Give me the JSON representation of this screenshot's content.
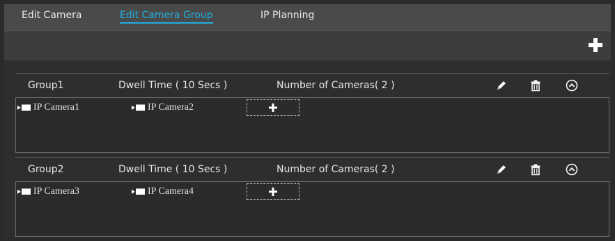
{
  "tabs": [
    {
      "label": "Edit Camera",
      "active": false
    },
    {
      "label": "Edit Camera Group",
      "active": true
    },
    {
      "label": "IP Planning",
      "active": false
    }
  ],
  "toolbar": {
    "add_icon": "plus-icon"
  },
  "groups": [
    {
      "name": "Group1",
      "dwell": "Dwell Time ( 10 Secs )",
      "count": "Number of Cameras( 2 )",
      "cameras": [
        "IP Camera1",
        "IP Camera2"
      ]
    },
    {
      "name": "Group2",
      "dwell": "Dwell Time ( 10 Secs )",
      "count": "Number of Cameras( 2 )",
      "cameras": [
        "IP Camera3",
        "IP Camera4"
      ]
    }
  ],
  "icons": {
    "edit": "pencil-icon",
    "delete": "trash-icon",
    "collapse": "chevron-up-circle-icon",
    "camera": "camera-icon",
    "add_camera": "plus-icon"
  },
  "colors": {
    "accent": "#1fb0e0",
    "background": "#2b2b2b",
    "tabbar": "#4a4a4a"
  }
}
